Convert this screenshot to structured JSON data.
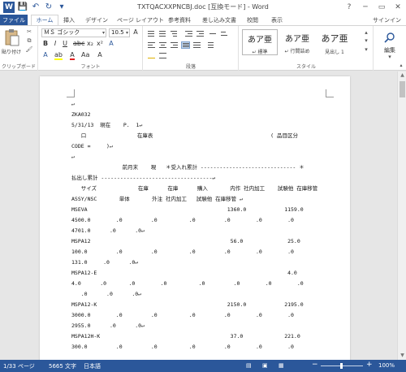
{
  "window": {
    "title": "TXTQACXXPNCBJ.doc [互換モード] - Word",
    "help": "?",
    "minimize": "─",
    "restore": "▭",
    "close": "✕"
  },
  "qat": {
    "logo": "W",
    "save": "💾",
    "undo": "↶",
    "redo": "↻",
    "more": "▾"
  },
  "tabs": [
    "ファイル",
    "ホーム",
    "挿入",
    "デザイン",
    "ページ レイアウト",
    "参考資料",
    "差し込み文書",
    "校閲",
    "表示"
  ],
  "signin": "サインイン",
  "ribbon": {
    "clipboard": {
      "paste": "貼り付け",
      "label": "クリップボード"
    },
    "font": {
      "name": "ＭＳ ゴシック",
      "size": "10.5",
      "label": "フォント"
    },
    "paragraph": {
      "label": "段落"
    },
    "styles": {
      "items": [
        {
          "sample": "あア亜",
          "name": "↵ 標準"
        },
        {
          "sample": "あア亜",
          "name": "↵ 行間詰め"
        },
        {
          "sample": "あア亜",
          "name": "見出し 1"
        }
      ],
      "label": "スタイル"
    },
    "editing": {
      "label": "編集"
    }
  },
  "document": {
    "lines": [
      "↵",
      "ZKA032",
      "5/31/13  現在    P.  1↵",
      "   口                在庫表                                     ( 品目区分",
      "CODE =     )↵",
      "↵",
      "                前月末    現   ＊受入れ累計 ------------------------------ ＊",
      "払出し累計 -----------------------------------↵",
      "   サイズ             在庫      在庫      購入       内作 社内加工    試験他 在庫移管",
      "ASSY/NSC       単体       外注 社内加工   試験他 在庫移管 ↵",
      "MSEVA                                            1360.0            1159.0",
      "4500.0        .0         .0          .0         .0        .0        .0",
      "4701.0      .0      .0↵",
      "MSPA12                                            56.0              25.0",
      "100.0         .0         .0          .0         .0        .0        .0",
      "131.0     .0      .0↵",
      "MSPA12-E                                                            4.0",
      "4.0      .0       .0        .0          .0         .0        .0        .0",
      "   .0      .0      .0↵",
      "MSPA12-K                                         2150.0            2195.0",
      "3000.0        .0         .0          .0         .0        .0        .0",
      "2955.0      .0      .0↵",
      "MSPA12H-K                                         37.0             221.0",
      "300.0         .0         .0          .0         .0        .0        .0"
    ]
  },
  "status": {
    "page": "1/33 ページ",
    "words": "5665 文字",
    "lang": "日本語",
    "zoom_minus": "−",
    "zoom_plus": "+",
    "zoom": "100%"
  },
  "colors": {
    "accent": "#2b579a"
  }
}
